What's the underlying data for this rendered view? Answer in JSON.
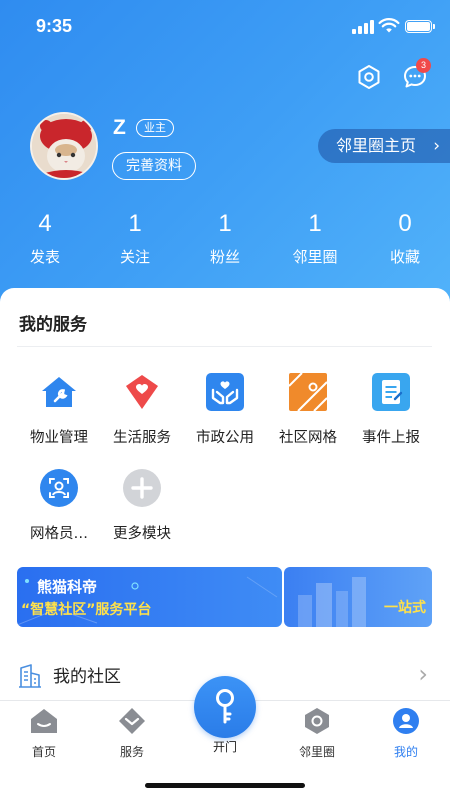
{
  "status_bar": {
    "time": "9:35"
  },
  "header": {
    "message_badge_count": "3"
  },
  "profile": {
    "username": "Z",
    "role_badge": "业主",
    "complete_profile_button": "完善资料",
    "neighbor_home_link": "邻里圈主页"
  },
  "stats": [
    {
      "value": "4",
      "label": "发表"
    },
    {
      "value": "1",
      "label": "关注"
    },
    {
      "value": "1",
      "label": "粉丝"
    },
    {
      "value": "1",
      "label": "邻里圈"
    },
    {
      "value": "0",
      "label": "收藏"
    }
  ],
  "my_services": {
    "title": "我的服务",
    "items": [
      {
        "label": "物业管理",
        "icon": "house-wrench-icon"
      },
      {
        "label": "生活服务",
        "icon": "heart-shield-icon"
      },
      {
        "label": "市政公用",
        "icon": "hands-heart-icon"
      },
      {
        "label": "社区网格",
        "icon": "grid-map-icon"
      },
      {
        "label": "事件上报",
        "icon": "report-document-icon"
      },
      {
        "label": "网格员…",
        "icon": "face-scan-icon"
      },
      {
        "label": "更多模块",
        "icon": "plus-icon"
      }
    ]
  },
  "banner": {
    "title": "熊猫科帝",
    "subtitle": "“智慧社区”服务平台",
    "right_text": "一站式"
  },
  "my_community": {
    "label": "我的社区"
  },
  "tabbar": {
    "items": [
      {
        "label": "首页",
        "icon": "home-icon"
      },
      {
        "label": "服务",
        "icon": "service-icon"
      },
      {
        "label": "开门",
        "icon": "key-icon"
      },
      {
        "label": "邻里圈",
        "icon": "neighbor-icon"
      },
      {
        "label": "我的",
        "icon": "profile-icon"
      }
    ],
    "active": "我的"
  },
  "colors": {
    "primary": "#2f8cf0",
    "active_tab": "#2f7ff0",
    "banner_accent": "#ffe14a",
    "badge": "#f04a4a"
  }
}
